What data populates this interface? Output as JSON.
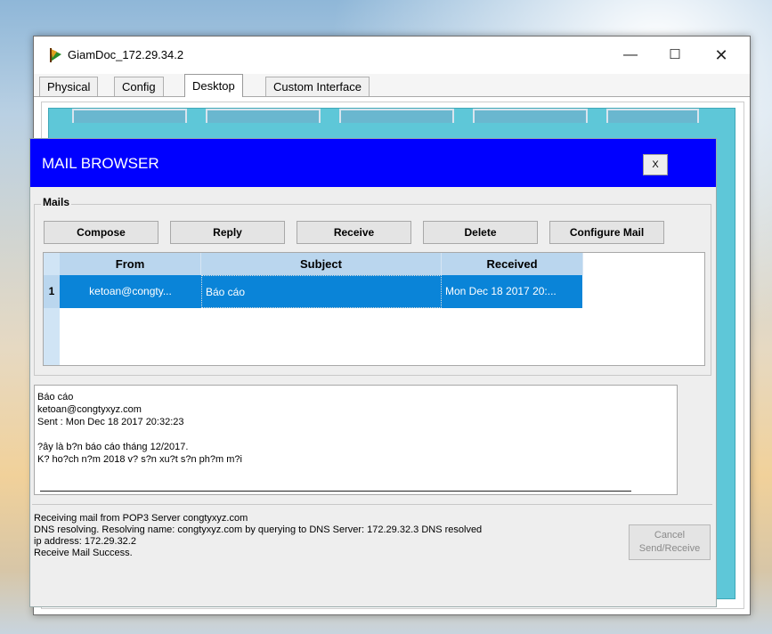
{
  "window": {
    "title": "GiamDoc_172.29.34.2",
    "minimize_symbol": "—",
    "maximize_symbol": "☐",
    "close_symbol": "✕"
  },
  "tabs": [
    {
      "label": "Physical",
      "active": false
    },
    {
      "label": "Config",
      "active": false
    },
    {
      "label": "Desktop",
      "active": true
    },
    {
      "label": "Custom Interface",
      "active": false
    }
  ],
  "mail": {
    "title": "MAIL BROWSER",
    "close_label": "X",
    "group_label": "Mails",
    "buttons": {
      "compose": "Compose",
      "reply": "Reply",
      "receive": "Receive",
      "delete": "Delete",
      "configure": "Configure Mail"
    },
    "table": {
      "columns": [
        "From",
        "Subject",
        "Received"
      ],
      "rows": [
        {
          "num": "1",
          "from": "ketoan@congty...",
          "subject": "Báo cáo",
          "received": "Mon Dec 18 2017 20:..."
        }
      ]
    },
    "body_lines": [
      "Báo cáo",
      "ketoan@congtyxyz.com",
      "Sent : Mon Dec 18 2017 20:32:23",
      "",
      "?ây là b?n báo cáo tháng 12/2017.",
      "K? ho?ch n?m 2018 v? s?n xu?t s?n ph?m m?i"
    ],
    "status_lines": [
      "Receiving mail from POP3 Server congtyxyz.com",
      "DNS resolving. Resolving name: congtyxyz.com by querying to DNS Server: 172.29.32.3  DNS resolved",
      "ip address: 172.29.32.2",
      "Receive Mail Success."
    ],
    "cancel_button": {
      "line1": "Cancel",
      "line2": "Send/Receive"
    }
  },
  "colors": {
    "header_blue": "#0000ff",
    "desktop_teal": "#5ec7d8",
    "selection_blue": "#0a84d8",
    "table_header": "#bad6ee"
  },
  "icons": {
    "app": "packet-tracer-device-icon"
  }
}
